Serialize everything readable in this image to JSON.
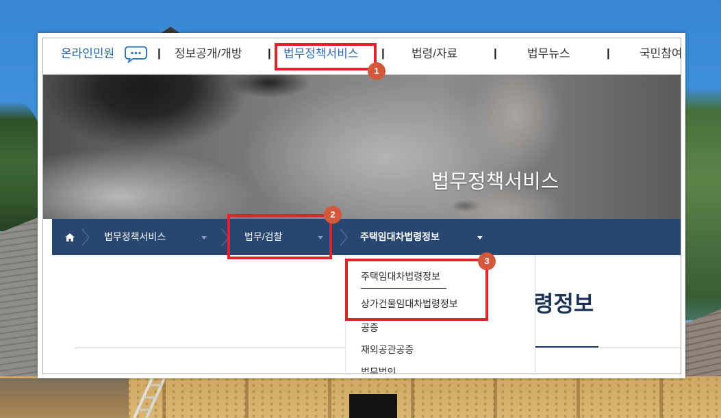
{
  "nav": {
    "separator": "|",
    "items": [
      {
        "label": "온라인민원"
      },
      {
        "label": "정보공개/개방"
      },
      {
        "label": "법무정책서비스",
        "active": true
      },
      {
        "label": "법령/자료"
      },
      {
        "label": "법무뉴스"
      },
      {
        "label": "국민참여"
      }
    ]
  },
  "banner": {
    "title": "법무정책서비스"
  },
  "breadcrumb": {
    "items": [
      {
        "label": "법무정책서비스"
      },
      {
        "label": "법무/검찰"
      },
      {
        "label": "주택임대차법령정보",
        "current": true
      }
    ]
  },
  "dropdown": {
    "items": [
      {
        "label": "주택임대차법령정보",
        "selected": true
      },
      {
        "label": "상가건물임대차법령정보"
      },
      {
        "label": "공증"
      },
      {
        "label": "재외공관공증"
      },
      {
        "label": "법무법인"
      }
    ]
  },
  "page": {
    "title": "령정보"
  },
  "annotations": [
    {
      "label": "1"
    },
    {
      "label": "2"
    },
    {
      "label": "3"
    }
  ],
  "icons": {
    "online_petition": "chat-bubble-icon",
    "breadcrumb_home": "home-icon",
    "breadcrumb_separator": "chevron-right-icon",
    "breadcrumb_toggle": "caret-down-icon"
  },
  "colors": {
    "brand_blue": "#1f5d9e",
    "active_nav": "#2c6ab3",
    "breadcrumb_bg": "#28466f",
    "annotation_red": "#e2232a",
    "badge": "#d4583b",
    "title": "#1b3254"
  }
}
